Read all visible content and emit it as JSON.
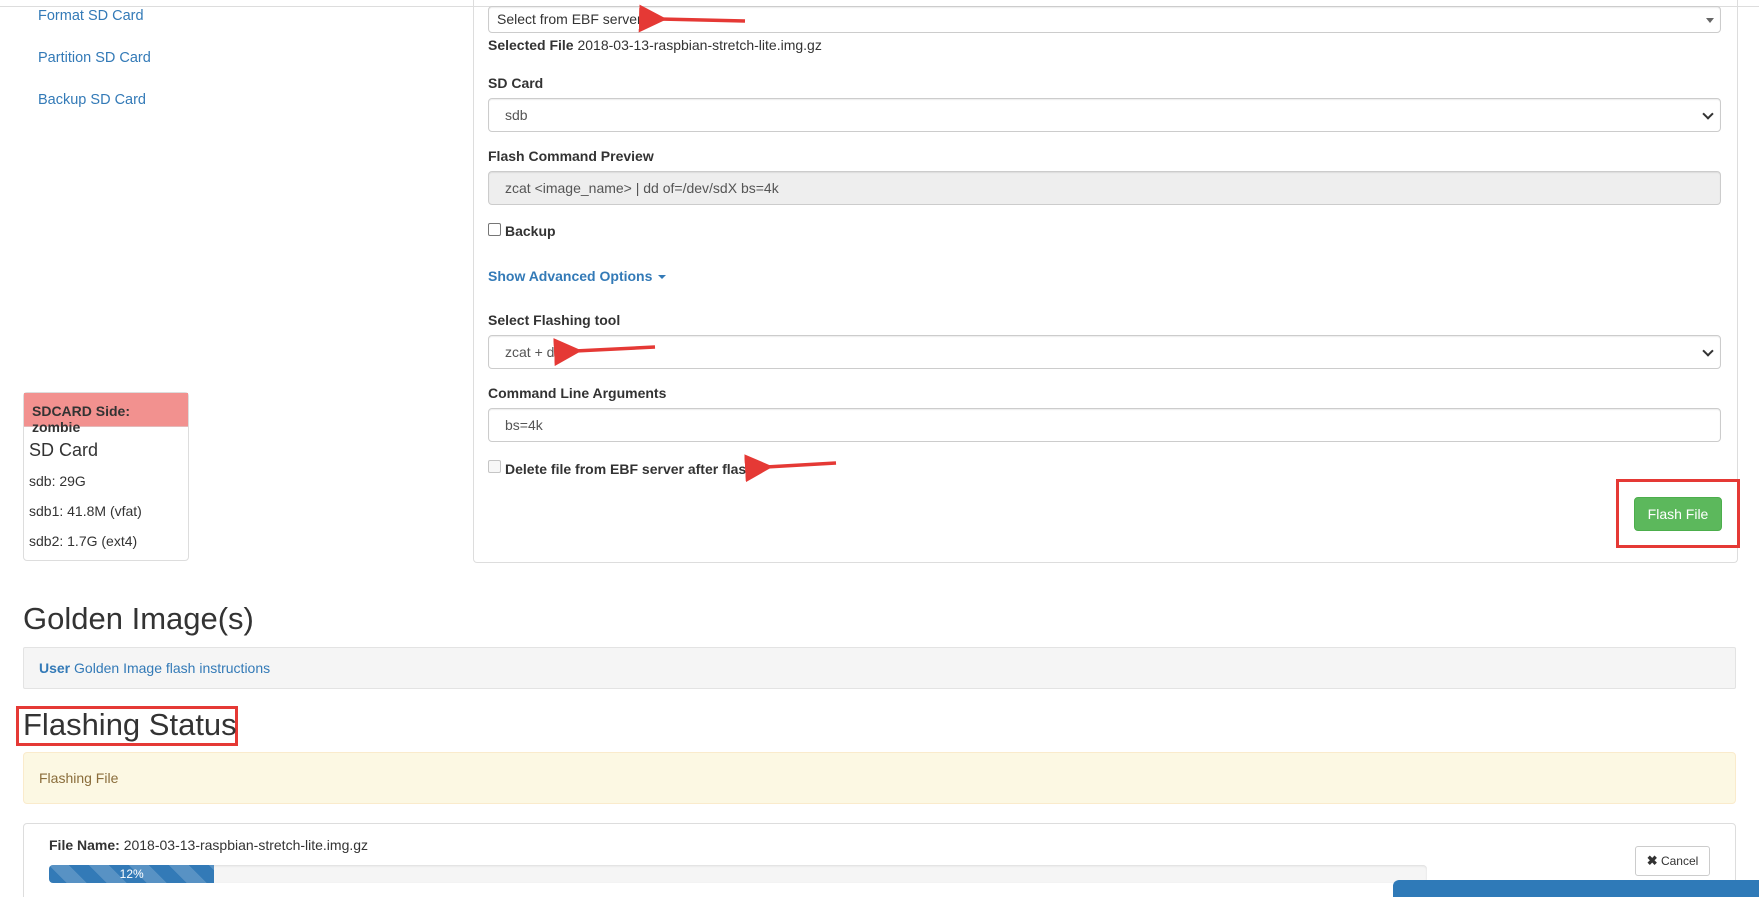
{
  "sidebar": {
    "links": [
      "Format SD Card",
      "Partition SD Card",
      "Backup SD Card"
    ]
  },
  "form": {
    "source_select": {
      "value": "Select from EBF server"
    },
    "selected_file": {
      "label": "Selected File",
      "value": "2018-03-13-raspbian-stretch-lite.img.gz"
    },
    "sd_card": {
      "label": "SD Card",
      "value": "sdb"
    },
    "flash_preview": {
      "label": "Flash Command Preview",
      "value": "zcat <image_name> | dd of=/dev/sdX bs=4k"
    },
    "backup": {
      "label": "Backup",
      "checked": false
    },
    "advanced_link": "Show Advanced Options",
    "flashing_tool": {
      "label": "Select Flashing tool",
      "value": "zcat + dd"
    },
    "cmd_args": {
      "label": "Command Line Arguments",
      "value": "bs=4k"
    },
    "delete_file": {
      "label": "Delete file from EBF server after flash",
      "checked": false,
      "disabled": true
    },
    "flash_button": "Flash File"
  },
  "sd_info": {
    "header": "SDCARD Side: zombie",
    "title": "SD Card",
    "items": [
      "sdb: 29G",
      "sdb1: 41.8M (vfat)",
      "sdb2: 1.7G (ext4)"
    ]
  },
  "golden": {
    "heading": "Golden Image(s)",
    "user_label": "User",
    "link": "Golden Image flash instructions"
  },
  "status": {
    "heading": "Flashing Status",
    "alert": "Flashing File",
    "file_name_label": "File Name:",
    "file_name": "2018-03-13-raspbian-stretch-lite.img.gz",
    "progress_percent": 12,
    "progress_label": "12%",
    "cancel_label": "Cancel"
  },
  "colors": {
    "link": "#337ab7",
    "success": "#5cb85c",
    "danger_header": "#f2918f",
    "annotation_red": "#e53935",
    "warning_bg": "#fcf8e3",
    "warning_text": "#8a6d3b"
  }
}
